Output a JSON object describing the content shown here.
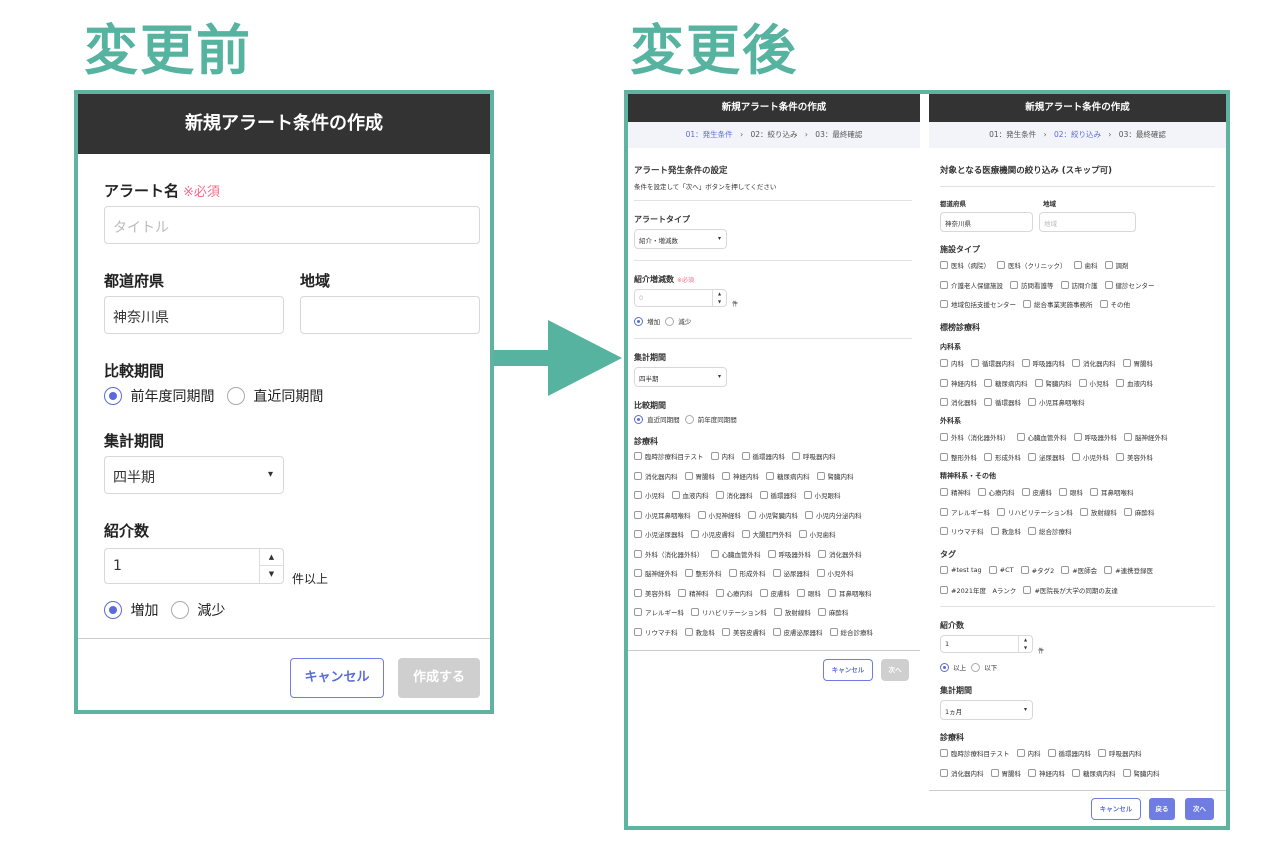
{
  "labels": {
    "before": "変更前",
    "after": "変更後"
  },
  "before": {
    "title": "新規アラート条件の作成",
    "alert_name_label": "アラート名",
    "required": "※必須",
    "title_placeholder": "タイトル",
    "prefecture_label": "都道府県",
    "region_label": "地域",
    "prefecture_value": "神奈川県",
    "compare_label": "比較期間",
    "compare_opt1": "前年度同期間",
    "compare_opt2": "直近同期間",
    "period_label": "集計期間",
    "period_value": "四半期",
    "count_label": "紹介数",
    "count_value": "1",
    "count_suffix": "件以上",
    "inc": "増加",
    "dec": "減少",
    "cancel": "キャンセル",
    "create": "作成する"
  },
  "after1": {
    "title": "新規アラート条件の作成",
    "step1": "01：発生条件",
    "step2": "02：絞り込み",
    "step3": "03：最終確認",
    "sep": "›",
    "section_title": "アラート発生条件の設定",
    "section_desc": "条件を設定して「次へ」ボタンを押してください",
    "alert_type_label": "アラートタイプ",
    "alert_type_value": "紹介・増減数",
    "change_label": "紹介増減数",
    "required": "※必須",
    "change_value": "0",
    "change_suffix": "件",
    "inc": "増加",
    "dec": "減少",
    "period_label": "集計期間",
    "period_value": "四半期",
    "compare_label": "比較期間",
    "compare_opt1": "直近同期間",
    "compare_opt2": "前年度同期間",
    "dept_label": "診療科",
    "dept_rows": [
      [
        "臨時診療科目テスト",
        "内科",
        "循環器内科",
        "呼吸器内科"
      ],
      [
        "消化器内科",
        "胃腸科",
        "神経内科",
        "糖尿病内科",
        "腎臓内科"
      ],
      [
        "小児科",
        "血液内科",
        "消化器科",
        "循環器科",
        "小児眼科"
      ],
      [
        "小児耳鼻咽喉科",
        "小児神経科",
        "小児腎臓内科",
        "小児内分泌内科"
      ],
      [
        "小児泌尿器科",
        "小児皮膚科",
        "大腸肛門外科",
        "小児歯科"
      ],
      [
        "外科（消化器外科）",
        "心臓血管外科",
        "呼吸器外科",
        "消化器外科"
      ],
      [
        "脳神経外科",
        "整形外科",
        "形成外科",
        "泌尿器科",
        "小児外科"
      ],
      [
        "美容外科",
        "精神科",
        "心療内科",
        "皮膚科",
        "眼科",
        "耳鼻咽喉科"
      ],
      [
        "アレルギー科",
        "リハビリテーション科",
        "放射線科",
        "麻酔科"
      ],
      [
        "リウマチ科",
        "救急科",
        "美容皮膚科",
        "皮膚泌尿器科",
        "総合診療科"
      ]
    ],
    "cancel": "キャンセル",
    "next": "次へ"
  },
  "after2": {
    "title": "新規アラート条件の作成",
    "step1": "01：発生条件",
    "step2": "02：絞り込み",
    "step3": "03：最終確認",
    "sep": "›",
    "section_title": "対象となる医療機関の絞り込み (スキップ可)",
    "prefecture_label": "都道府県",
    "region_label": "地域",
    "prefecture_value": "神奈川県",
    "region_placeholder": "地域",
    "facility_label": "施設タイプ",
    "facility_rows": [
      [
        "医科（病院）",
        "医科（クリニック）",
        "歯科",
        "調剤"
      ],
      [
        "介護老人保健施設",
        "訪問看護等",
        "訪問介護",
        "健診センター"
      ],
      [
        "地域包括支援センター",
        "総合事業実施事務所",
        "その他"
      ]
    ],
    "standard_label": "標榜診療科",
    "internal_label": "内科系",
    "internal_rows": [
      [
        "内科",
        "循環器内科",
        "呼吸器内科",
        "消化器内科",
        "胃腸科"
      ],
      [
        "神経内科",
        "糖尿病内科",
        "腎臓内科",
        "小児科",
        "血液内科"
      ],
      [
        "消化器科",
        "循環器科",
        "小児耳鼻咽喉科"
      ]
    ],
    "surgery_label": "外科系",
    "surgery_rows": [
      [
        "外科（消化器外科）",
        "心臓血管外科",
        "呼吸器外科",
        "脳神経外科"
      ],
      [
        "整形外科",
        "形成外科",
        "泌尿器科",
        "小児外科",
        "美容外科"
      ]
    ],
    "psych_label": "精神科系・その他",
    "psych_rows": [
      [
        "精神科",
        "心療内科",
        "皮膚科",
        "眼科",
        "耳鼻咽喉科"
      ],
      [
        "アレルギー科",
        "リハビリテーション科",
        "放射線科",
        "麻酔科"
      ],
      [
        "リウマチ科",
        "救急科",
        "総合診療科"
      ]
    ],
    "tag_label": "タグ",
    "tag_rows": [
      [
        "#test tag",
        "#CT",
        "#タグ2",
        "#医師会",
        "#連携登録医"
      ],
      [
        "#2021年度　Aランク",
        "#医院長が大学の同期の友達"
      ]
    ],
    "count_label": "紹介数",
    "count_value": "1",
    "count_suffix": "件",
    "above": "以上",
    "below": "以下",
    "period_label": "集計期間",
    "period_value": "1ヵ月",
    "dept_label": "診療科",
    "dept_rows": [
      [
        "臨時診療科目テスト",
        "内科",
        "循環器内科",
        "呼吸器内科"
      ],
      [
        "消化器内科",
        "胃腸科",
        "神経内科",
        "糖尿病内科",
        "腎臓内科"
      ]
    ],
    "cancel": "キャンセル",
    "back": "戻る",
    "next": "次へ"
  },
  "colors": {
    "accent": "#5fb3a1",
    "primary": "#6f7de3",
    "required": "#f36c8a",
    "header": "#333333"
  }
}
